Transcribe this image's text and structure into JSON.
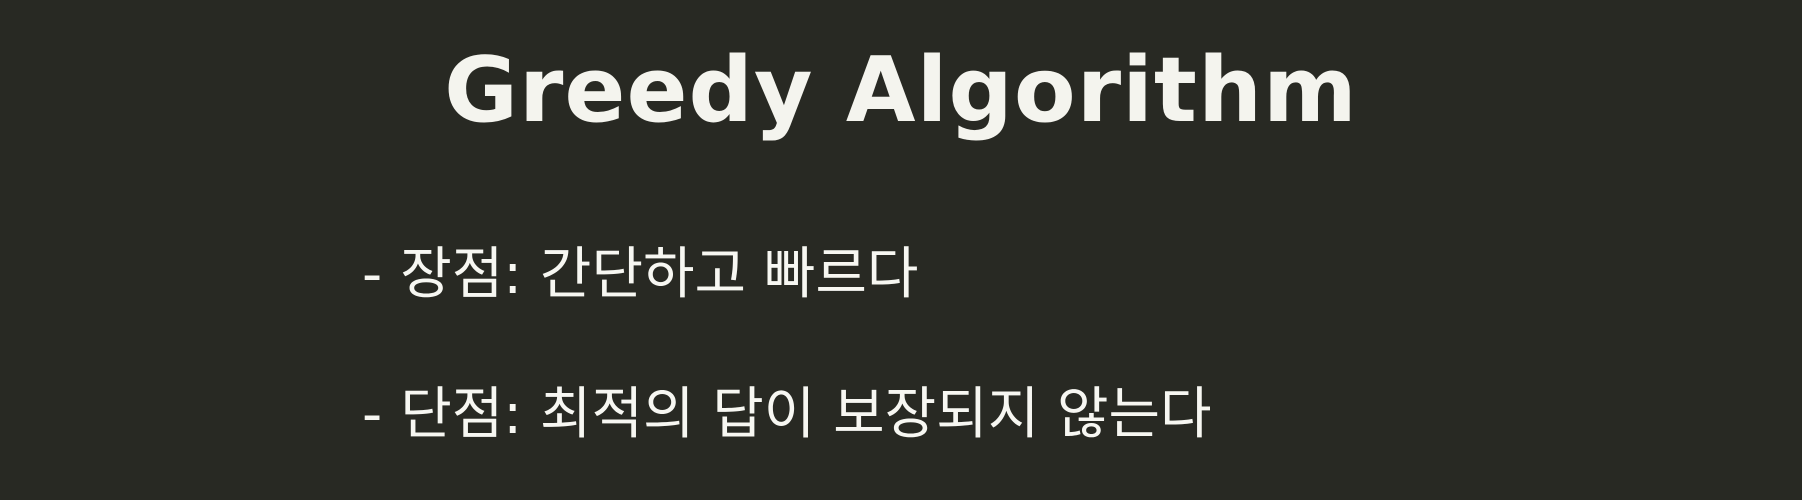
{
  "slide": {
    "title": "Greedy Algorithm",
    "bullets": [
      {
        "marker": "-",
        "text": "장점: 간단하고 빠르다"
      },
      {
        "marker": "-",
        "text": "단점: 최적의 답이 보장되지 않는다"
      }
    ]
  },
  "colors": {
    "background": "#282923",
    "text": "#f4f4ee"
  }
}
